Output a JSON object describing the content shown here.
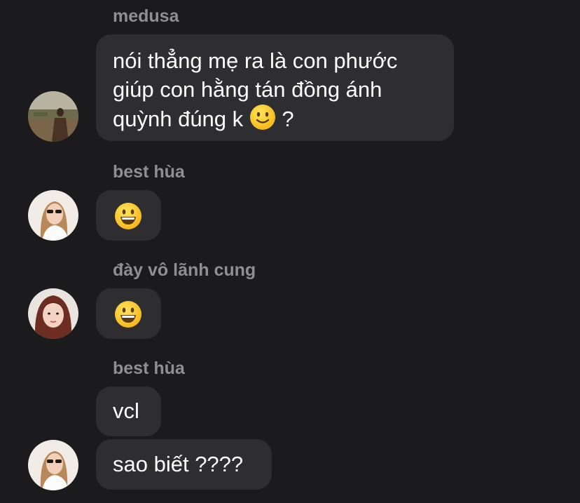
{
  "messages": [
    {
      "sender": "medusa",
      "text": "nói thẳng mẹ ra là con phước\ngiúp con hằng tán đồng ánh\nquỳnh đúng k",
      "emoji": "slightly-smiling-face",
      "suffix": " ?",
      "avatar": "outdoor-photo-avatar"
    },
    {
      "sender": "best hùa",
      "emoji": "grinning-face",
      "avatar": "sunglasses-girl-avatar"
    },
    {
      "sender": "đày vô lãnh cung",
      "emoji": "grinning-face",
      "avatar": "red-hair-girl-avatar"
    },
    {
      "sender": "best hùa",
      "texts": [
        "vcl",
        "sao biết ????"
      ],
      "avatar": "sunglasses-girl-avatar"
    }
  ],
  "colors": {
    "background": "#1b1b1e",
    "bubble": "#2e2e31",
    "sender_name": "#8e8e93",
    "message_text": "#ffffff"
  }
}
